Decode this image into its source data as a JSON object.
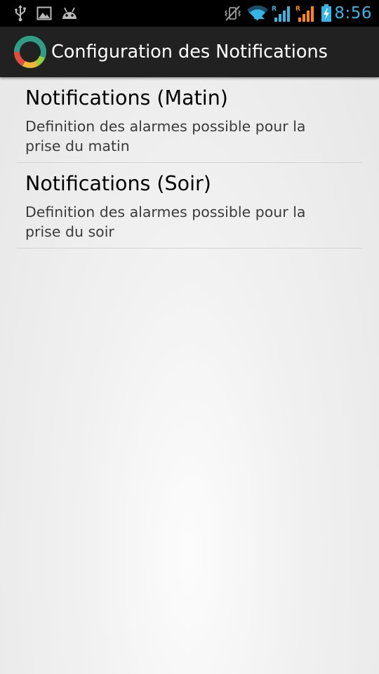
{
  "status_bar": {
    "time": "8:56",
    "time_color": "#33b5e5",
    "left_icons": [
      "usb-icon",
      "image-icon",
      "android-icon"
    ],
    "right_icons": [
      "vibrate-muted-icon",
      "wifi-icon",
      "signal-r-blue-icon",
      "signal-r-orange-icon",
      "battery-charging-icon"
    ],
    "roaming_label": "R"
  },
  "action_bar": {
    "title": "Configuration des Notifications",
    "icon": "app-ring-icon",
    "background": "#212121"
  },
  "preferences": [
    {
      "title": "Notifications (Matin)",
      "summary": "Definition des alarmes possible pour la prise du matin"
    },
    {
      "title": "Notifications (Soir)",
      "summary": "Definition des alarmes possible pour la prise du soir"
    }
  ]
}
